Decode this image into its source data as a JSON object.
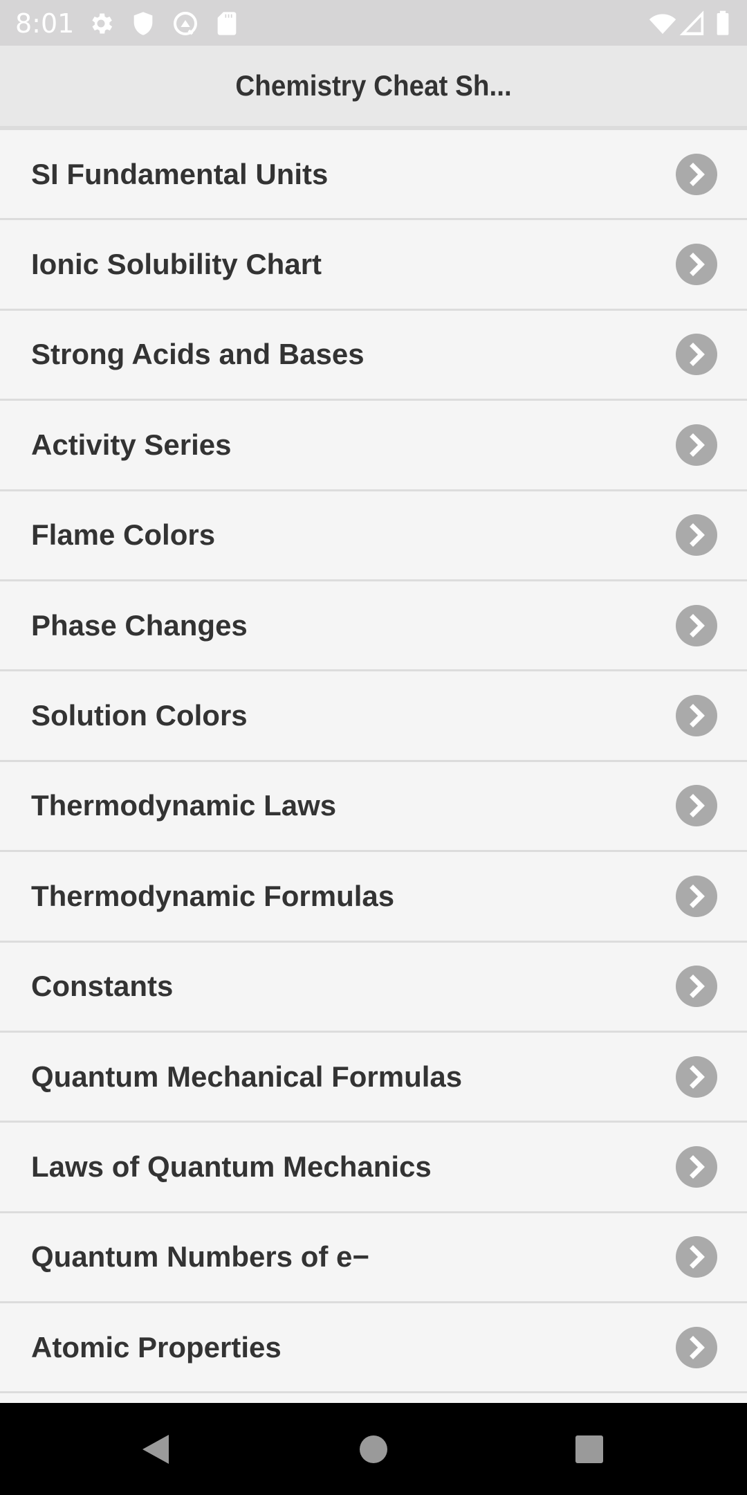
{
  "status_bar": {
    "time": "8:01",
    "left_icons": [
      "gear-icon",
      "shield-icon",
      "at-sign-icon",
      "sd-card-icon"
    ],
    "right_icons": [
      "wifi-icon",
      "cell-signal-icon",
      "battery-icon"
    ]
  },
  "header": {
    "title": "Chemistry Cheat Sh..."
  },
  "list": {
    "items": [
      {
        "label": "SI Fundamental Units"
      },
      {
        "label": "Ionic Solubility Chart"
      },
      {
        "label": "Strong Acids and Bases"
      },
      {
        "label": "Activity Series"
      },
      {
        "label": "Flame Colors"
      },
      {
        "label": "Phase Changes"
      },
      {
        "label": "Solution Colors"
      },
      {
        "label": "Thermodynamic Laws"
      },
      {
        "label": "Thermodynamic Formulas"
      },
      {
        "label": "Constants"
      },
      {
        "label": "Quantum Mechanical Formulas"
      },
      {
        "label": "Laws of Quantum Mechanics"
      },
      {
        "label": "Quantum Numbers of e−"
      },
      {
        "label": "Atomic Properties"
      }
    ]
  },
  "nav_bar": {
    "buttons": [
      "back",
      "home",
      "recents"
    ]
  },
  "colors": {
    "status_bar_bg": "#d6d5d6",
    "header_bg": "#e8e8e8",
    "list_bg": "#f5f5f5",
    "divider": "#dcdcdc",
    "text": "#333333",
    "chevron_bg": "#aaaaaa",
    "nav_bar_bg": "#000000",
    "nav_icon": "#9a9a9a"
  }
}
